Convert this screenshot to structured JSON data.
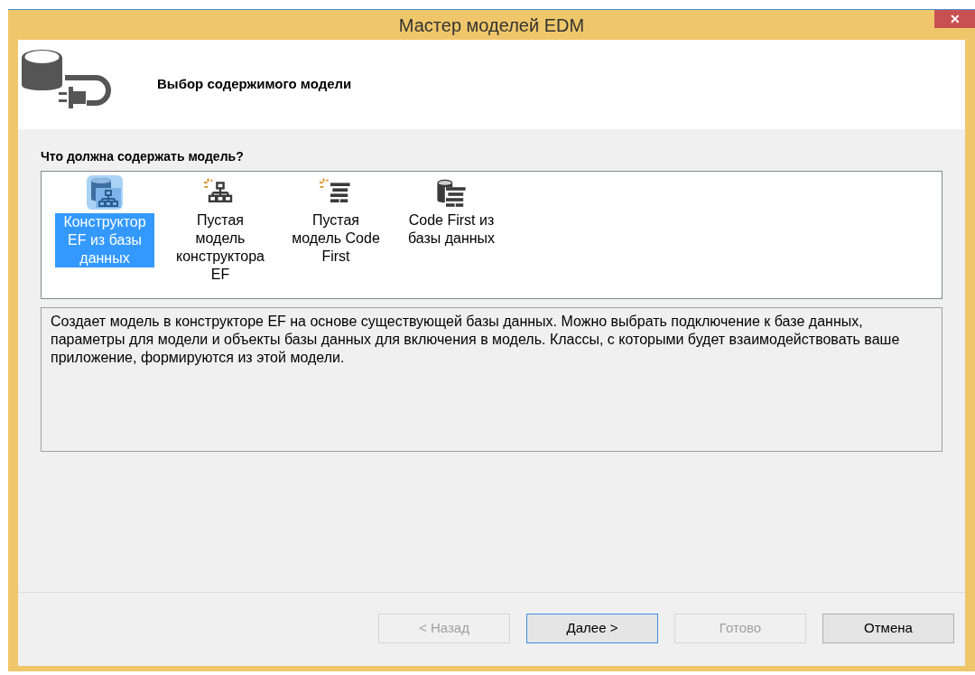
{
  "window": {
    "title": "Мастер моделей EDM",
    "close": "✕"
  },
  "header": {
    "title": "Выбор содержимого модели"
  },
  "prompt": "Что должна содержать модель?",
  "items": [
    {
      "kind": "db-designer",
      "label": "Конструктор EF из базы данных",
      "selected": true
    },
    {
      "kind": "empty-designer",
      "label": "Пустая модель конструктора EF",
      "selected": false
    },
    {
      "kind": "empty-code",
      "label": "Пустая модель Code First",
      "selected": false
    },
    {
      "kind": "db-code",
      "label": "Code First из базы данных",
      "selected": false
    }
  ],
  "description": "Создает модель в конструкторе EF на основе существующей базы данных. Можно выбрать подключение к базе данных, параметры для модели и объекты базы данных для включения в модель. Классы, с которыми будет взаимодействовать ваше приложение, формируются из этой модели.",
  "buttons": [
    {
      "label": "< Назад",
      "disabled": true,
      "default": false
    },
    {
      "label": "Далее >",
      "disabled": false,
      "default": true
    },
    {
      "label": "Готово",
      "disabled": true,
      "default": false
    },
    {
      "label": "Отмена",
      "disabled": false,
      "default": false
    }
  ]
}
